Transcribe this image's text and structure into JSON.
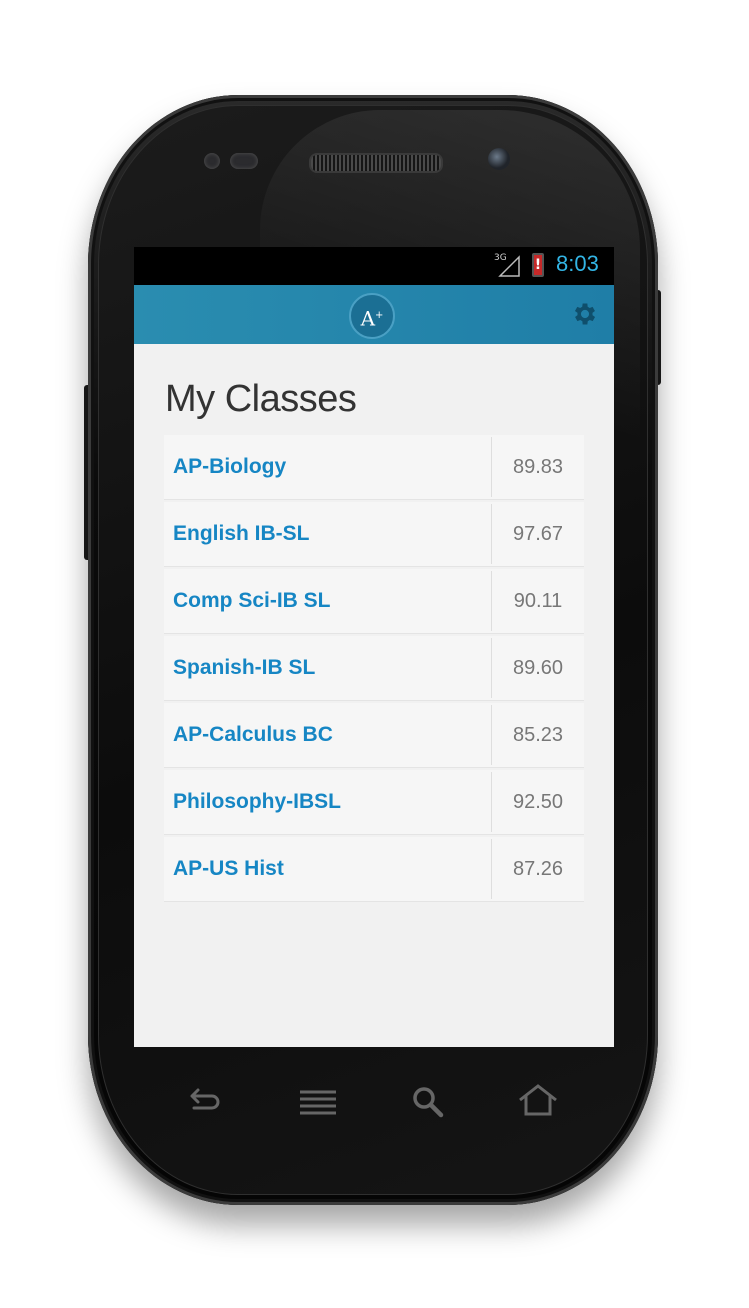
{
  "status_bar": {
    "network": "3G",
    "time": "8:03",
    "battery_color": "#c62828",
    "battery_glyph": "!",
    "time_color": "#33b5e5"
  },
  "action_bar": {
    "logo_text": "A",
    "logo_sup": "+",
    "settings_icon": "gear-icon",
    "accent": "#2a8db0"
  },
  "page": {
    "title": "My Classes"
  },
  "classes": [
    {
      "name": "AP-Biology",
      "grade": "89.83"
    },
    {
      "name": "English IB-SL",
      "grade": "97.67"
    },
    {
      "name": "Comp Sci-IB SL",
      "grade": "90.11"
    },
    {
      "name": "Spanish-IB SL",
      "grade": "89.60"
    },
    {
      "name": "AP-Calculus BC",
      "grade": "85.23"
    },
    {
      "name": "Philosophy-IBSL",
      "grade": "92.50"
    },
    {
      "name": "AP-US Hist",
      "grade": "87.26"
    }
  ],
  "nav_keys": [
    "back-icon",
    "menu-icon",
    "search-icon",
    "home-icon"
  ]
}
